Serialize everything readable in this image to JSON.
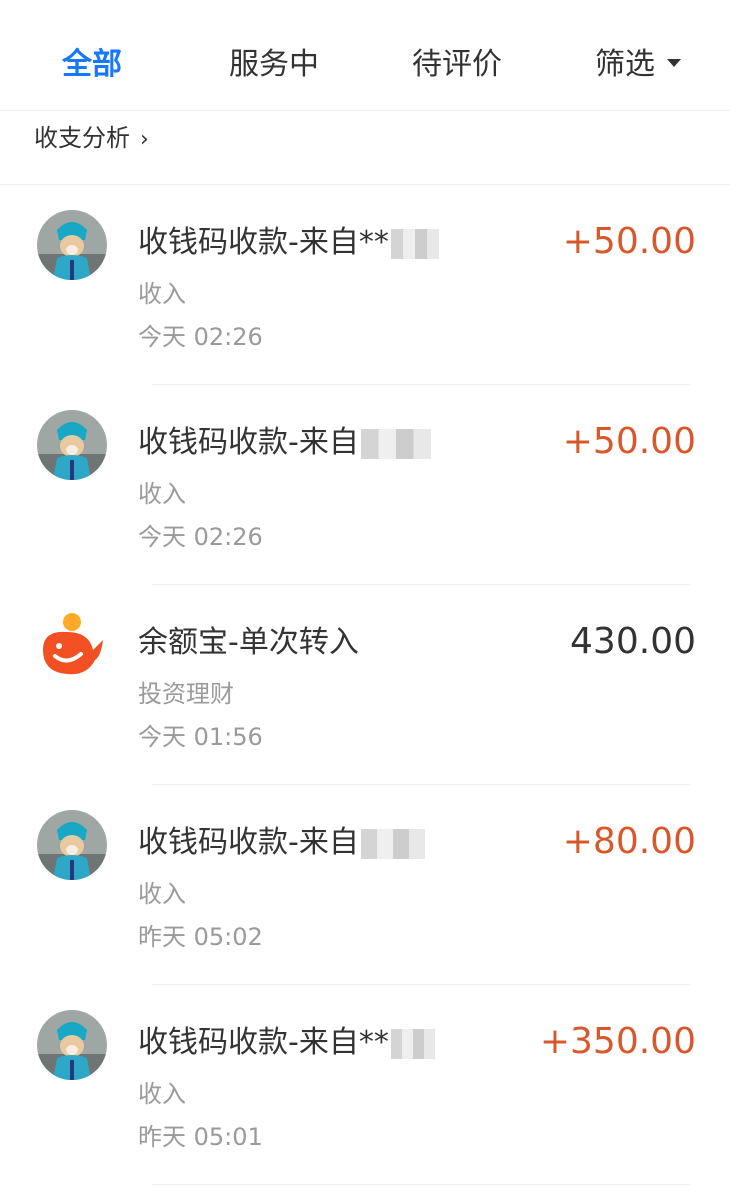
{
  "tabs": [
    {
      "label": "全部",
      "active": true
    },
    {
      "label": "服务中"
    },
    {
      "label": "待评价"
    },
    {
      "label": "筛选"
    }
  ],
  "analysis_link": {
    "label": "收支分析",
    "chevron": "›"
  },
  "transactions": [
    {
      "avatar": "dog-avatar",
      "title": "收钱码收款-来自**",
      "category": "收入",
      "time": "今天  02:26",
      "amount": "+50.00"
    },
    {
      "avatar": "dog-avatar",
      "title": "收钱码收款-来自",
      "category": "收入",
      "time": "今天  02:26",
      "amount": "+50.00"
    },
    {
      "avatar": "yuebao-logo",
      "title": "余额宝-单次转入",
      "category": "投资理财",
      "time": "今天  01:56",
      "amount": "430.00"
    },
    {
      "avatar": "dog-avatar",
      "title": "收钱码收款-来自",
      "category": "收入",
      "time": "昨天  05:02",
      "amount": "+80.00"
    },
    {
      "avatar": "dog-avatar",
      "title": "收钱码收款-来自**",
      "category": "收入",
      "time": "昨天  05:01",
      "amount": "+350.00"
    }
  ],
  "colors": {
    "accent": "#1677ff",
    "income": "#d9582b",
    "text": "#333333",
    "muted": "#9a9a9a",
    "yuebao": "#f25022"
  }
}
